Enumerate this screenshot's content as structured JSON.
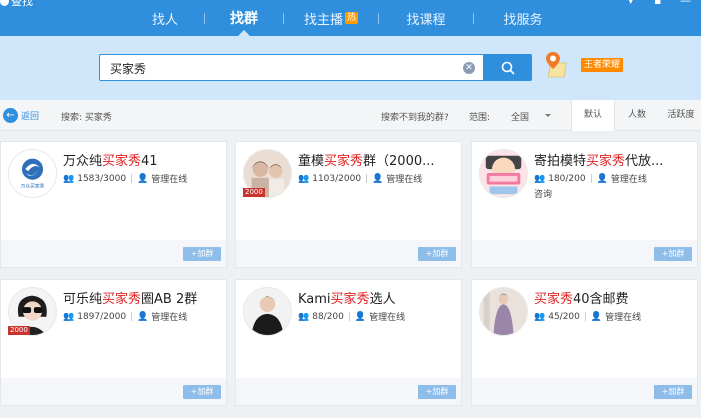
{
  "app": {
    "title": "查找"
  },
  "nav": {
    "tabs": [
      {
        "label": "找人"
      },
      {
        "label": "找群"
      },
      {
        "label": "找主播",
        "badge": "热"
      },
      {
        "label": "找课程"
      },
      {
        "label": "找服务"
      }
    ]
  },
  "search": {
    "value": "买家秀",
    "hero_badge": "王者荣耀"
  },
  "filter": {
    "back_label": "返回",
    "search_label": "搜索: 买家秀",
    "cant_find": "搜索不到我的群?",
    "range_label": "范围:",
    "range_value": "全国",
    "sort_tabs": [
      "默认",
      "人数",
      "活跃度"
    ]
  },
  "groups": [
    {
      "name_pre": "万众纯",
      "name_hl": "买家秀",
      "name_post": "41",
      "members": "1583/3000",
      "status": "管理在线",
      "join": "+加群",
      "avatar_text": "万众买家秀"
    },
    {
      "name_pre": "童模",
      "name_hl": "买家秀",
      "name_post": "群（2000...",
      "members": "1103/2000",
      "status": "管理在线",
      "join": "+加群",
      "tag": "2000"
    },
    {
      "name_pre": "寄拍模特",
      "name_hl": "买家秀",
      "name_post": "代放...",
      "members": "180/200",
      "status": "管理在线",
      "extra": "咨询",
      "join": "+加群"
    },
    {
      "name_pre": "可乐纯",
      "name_hl": "买家秀",
      "name_post": "圈AB 2群",
      "members": "1897/2000",
      "status": "管理在线",
      "join": "+加群",
      "tag": "2000"
    },
    {
      "name_pre": "Kami",
      "name_hl": "买家秀",
      "name_post": "选人",
      "members": "88/200",
      "status": "管理在线",
      "join": "+加群"
    },
    {
      "name_pre": "",
      "name_hl": "买家秀",
      "name_post": "40含邮费",
      "members": "45/200",
      "status": "管理在线",
      "join": "+加群"
    }
  ],
  "colors": {
    "primary": "#2f8fdd",
    "highlight": "#e02020",
    "band": "#cfe6fb"
  }
}
